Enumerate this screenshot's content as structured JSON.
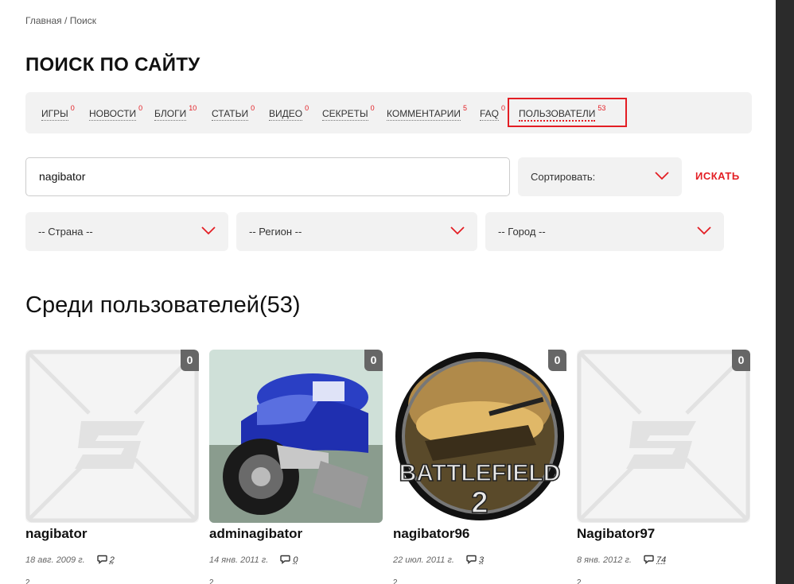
{
  "breadcrumb": {
    "home": "Главная",
    "sep": " / ",
    "current": "Поиск"
  },
  "page_title": "ПОИСК ПО САЙТУ",
  "tabs": [
    {
      "label": "ИГРЫ",
      "count": "0"
    },
    {
      "label": "НОВОСТИ",
      "count": "0"
    },
    {
      "label": "БЛОГИ",
      "count": "10"
    },
    {
      "label": "СТАТЬИ",
      "count": "0"
    },
    {
      "label": "ВИДЕО",
      "count": "0"
    },
    {
      "label": "СЕКРЕТЫ",
      "count": "0"
    },
    {
      "label": "КОММЕНТАРИИ",
      "count": "5"
    },
    {
      "label": "FAQ",
      "count": "0"
    },
    {
      "label": "ПОЛЬЗОВАТЕЛИ",
      "count": "53"
    }
  ],
  "search": {
    "value": "nagibator",
    "sort_label": "Сортировать:",
    "button": "ИСКАТЬ"
  },
  "filters": {
    "country": "-- Страна --",
    "region": "-- Регион --",
    "city": "-- Город --"
  },
  "section_title": "Среди пользователей(53)",
  "users": [
    {
      "name": "nagibator",
      "date": "18 авг. 2009 г.",
      "comments": "2",
      "badge": "0",
      "extra": "2",
      "avatar": "placeholder"
    },
    {
      "name": "adminagibator",
      "date": "14 янв. 2011 г.",
      "comments": "0",
      "badge": "0",
      "extra": "2",
      "avatar": "motorcycle"
    },
    {
      "name": "nagibator96",
      "date": "22 июл. 2011 г.",
      "comments": "3",
      "badge": "0",
      "extra": "2",
      "avatar": "battlefield",
      "avatar_text": "BATTLEFIELD",
      "avatar_num": "2"
    },
    {
      "name": "Nagibator97",
      "date": "8 янв. 2012 г.",
      "comments": "74",
      "badge": "0",
      "extra": "2",
      "avatar": "placeholder"
    }
  ],
  "colors": {
    "accent": "#e31e24",
    "panel": "#f2f2f2",
    "badge": "#666666"
  }
}
